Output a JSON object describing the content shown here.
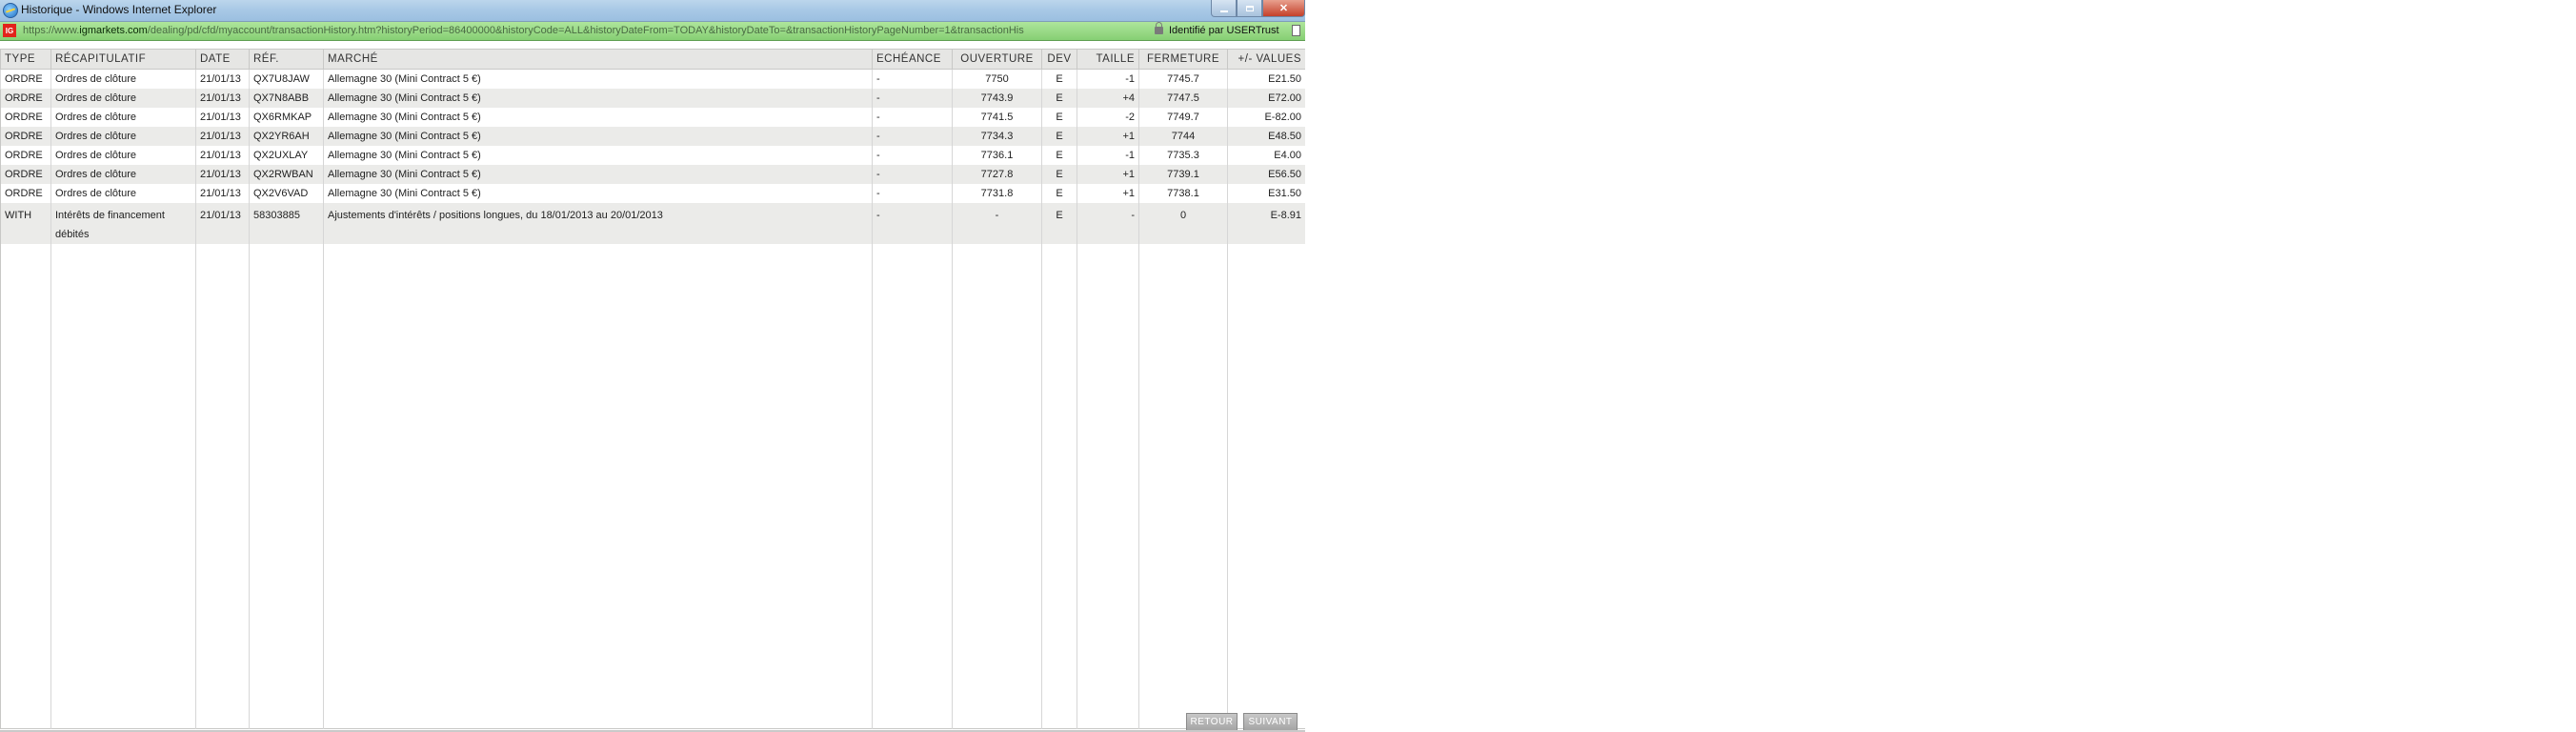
{
  "window": {
    "title": "Historique - Windows Internet Explorer"
  },
  "address": {
    "url_prefix": "https://www.",
    "url_domain": "igmarkets.com",
    "url_path": "/dealing/pd/cfd/myaccount/transactionHistory.htm?historyPeriod=86400000&historyCode=ALL&historyDateFrom=TODAY&historyDateTo=&transactionHistoryPageNumber=1&transactionHis",
    "logo_text": "IG",
    "identity": "Identifié par USERTrust"
  },
  "table": {
    "headers": [
      "TYPE",
      "RÉCAPITULATIF",
      "DATE",
      "RÉF.",
      "MARCHÉ",
      "ECHÉANCE",
      "OUVERTURE",
      "DEV",
      "TAILLE",
      "FERMETURE",
      "+/- VALUES"
    ],
    "rows": [
      [
        "ORDRE",
        "Ordres de clôture",
        "21/01/13",
        "QX7U8JAW",
        "Allemagne 30 (Mini Contract 5 €)",
        "-",
        "7750",
        "E",
        "-1",
        "7745.7",
        "E21.50"
      ],
      [
        "ORDRE",
        "Ordres de clôture",
        "21/01/13",
        "QX7N8ABB",
        "Allemagne 30 (Mini Contract 5 €)",
        "-",
        "7743.9",
        "E",
        "+4",
        "7747.5",
        "E72.00"
      ],
      [
        "ORDRE",
        "Ordres de clôture",
        "21/01/13",
        "QX6RMKAP",
        "Allemagne 30 (Mini Contract 5 €)",
        "-",
        "7741.5",
        "E",
        "-2",
        "7749.7",
        "E-82.00"
      ],
      [
        "ORDRE",
        "Ordres de clôture",
        "21/01/13",
        "QX2YR6AH",
        "Allemagne 30 (Mini Contract 5 €)",
        "-",
        "7734.3",
        "E",
        "+1",
        "7744",
        "E48.50"
      ],
      [
        "ORDRE",
        "Ordres de clôture",
        "21/01/13",
        "QX2UXLAY",
        "Allemagne 30 (Mini Contract 5 €)",
        "-",
        "7736.1",
        "E",
        "-1",
        "7735.3",
        "E4.00"
      ],
      [
        "ORDRE",
        "Ordres de clôture",
        "21/01/13",
        "QX2RWBAN",
        "Allemagne 30 (Mini Contract 5 €)",
        "-",
        "7727.8",
        "E",
        "+1",
        "7739.1",
        "E56.50"
      ],
      [
        "ORDRE",
        "Ordres de clôture",
        "21/01/13",
        "QX2V6VAD",
        "Allemagne 30 (Mini Contract 5 €)",
        "-",
        "7731.8",
        "E",
        "+1",
        "7738.1",
        "E31.50"
      ],
      [
        "WITH",
        "Intérêts de financement débités",
        "21/01/13",
        "58303885",
        "Ajustements d'intérêts / positions longues, du 18/01/2013 au 20/01/2013",
        "-",
        "-",
        "E",
        "-",
        "0",
        "E-8.91"
      ]
    ]
  },
  "footer": {
    "back_label": "RETOUR",
    "next_label": "SUIVANT"
  }
}
